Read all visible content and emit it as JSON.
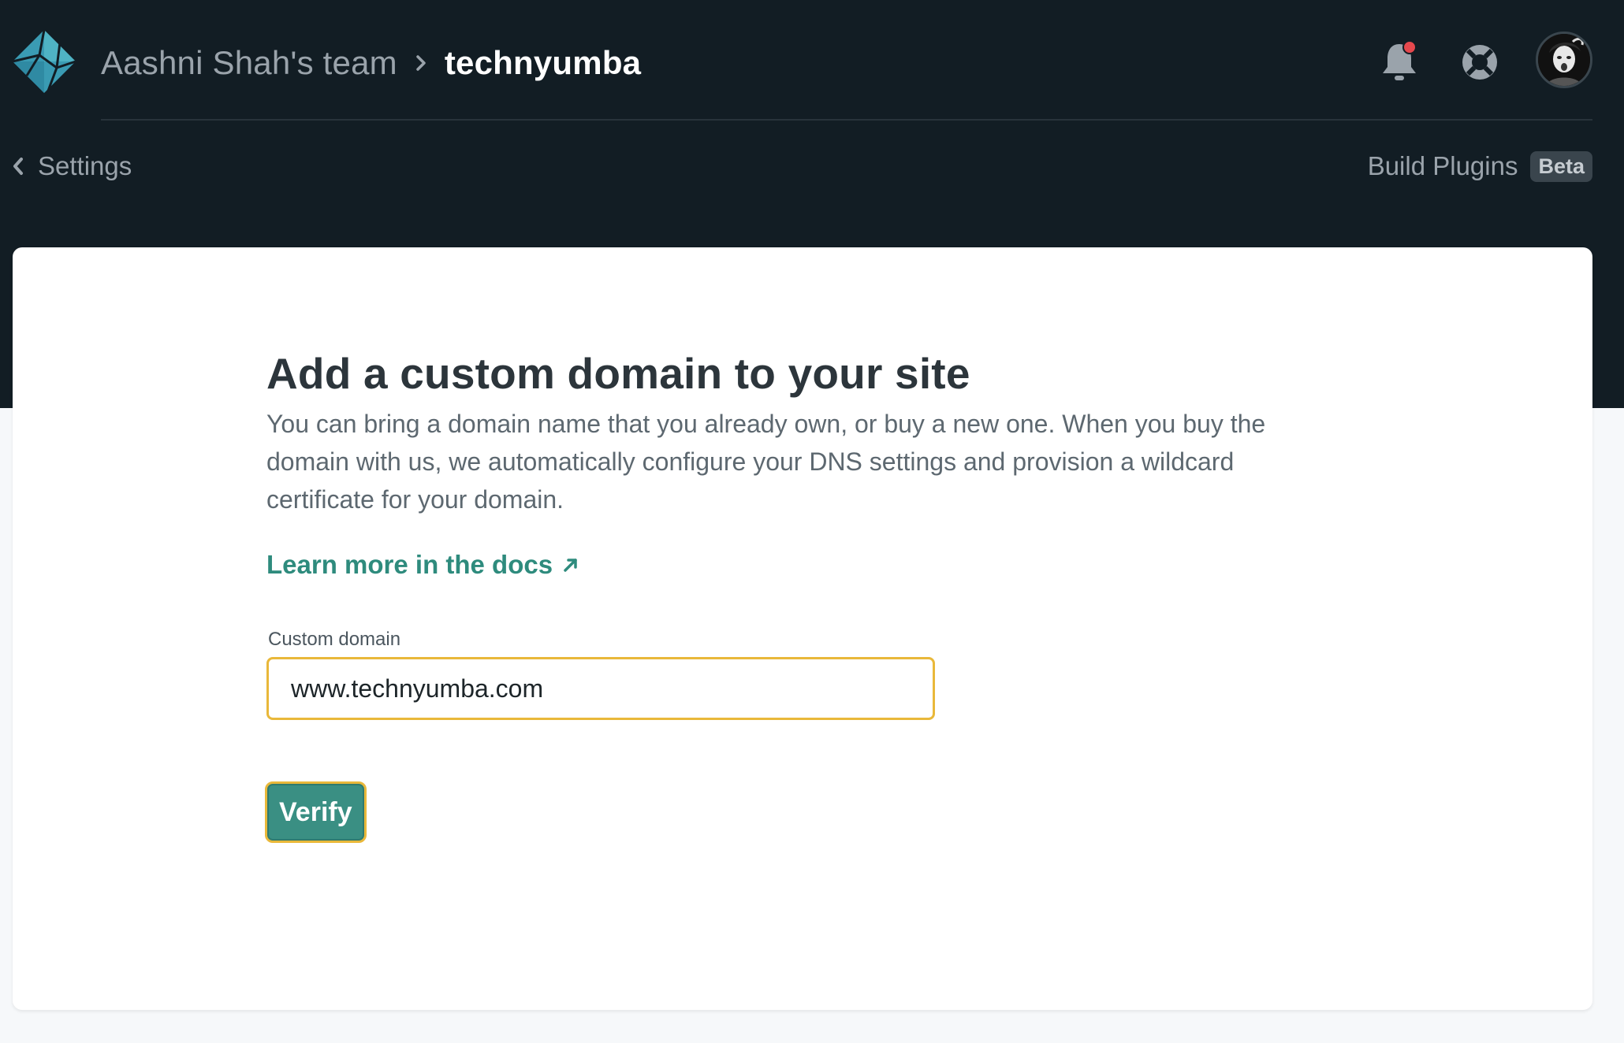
{
  "header": {
    "team_name": "Aashni Shah's team",
    "breadcrumb_separator_icon": "chevron-right-icon",
    "site_name": "technyumba",
    "logo_icon": "netlify-logo",
    "notifications_icon": "bell-icon",
    "notification_indicator_color": "#e5484d",
    "help_icon": "lifebuoy-icon",
    "avatar_icon": "user-avatar"
  },
  "subnav": {
    "back_label": "Settings",
    "back_icon": "chevron-left-icon",
    "build_plugins_label": "Build Plugins",
    "beta_badge": "Beta"
  },
  "main": {
    "title": "Add a custom domain to your site",
    "description": "You can bring a domain name that you already own, or buy a new one. When you buy the domain with us, we automatically configure your DNS settings and provision a wildcard certificate for your domain.",
    "docs_link_label": "Learn more in the docs",
    "docs_link_icon": "external-arrow-icon",
    "field_label": "Custom domain",
    "domain_value": "www.technyumba.com",
    "verify_label": "Verify"
  },
  "colors": {
    "header_background": "#121d24",
    "accent_teal": "#3a8f83",
    "focus_ring": "#e9b83a"
  }
}
